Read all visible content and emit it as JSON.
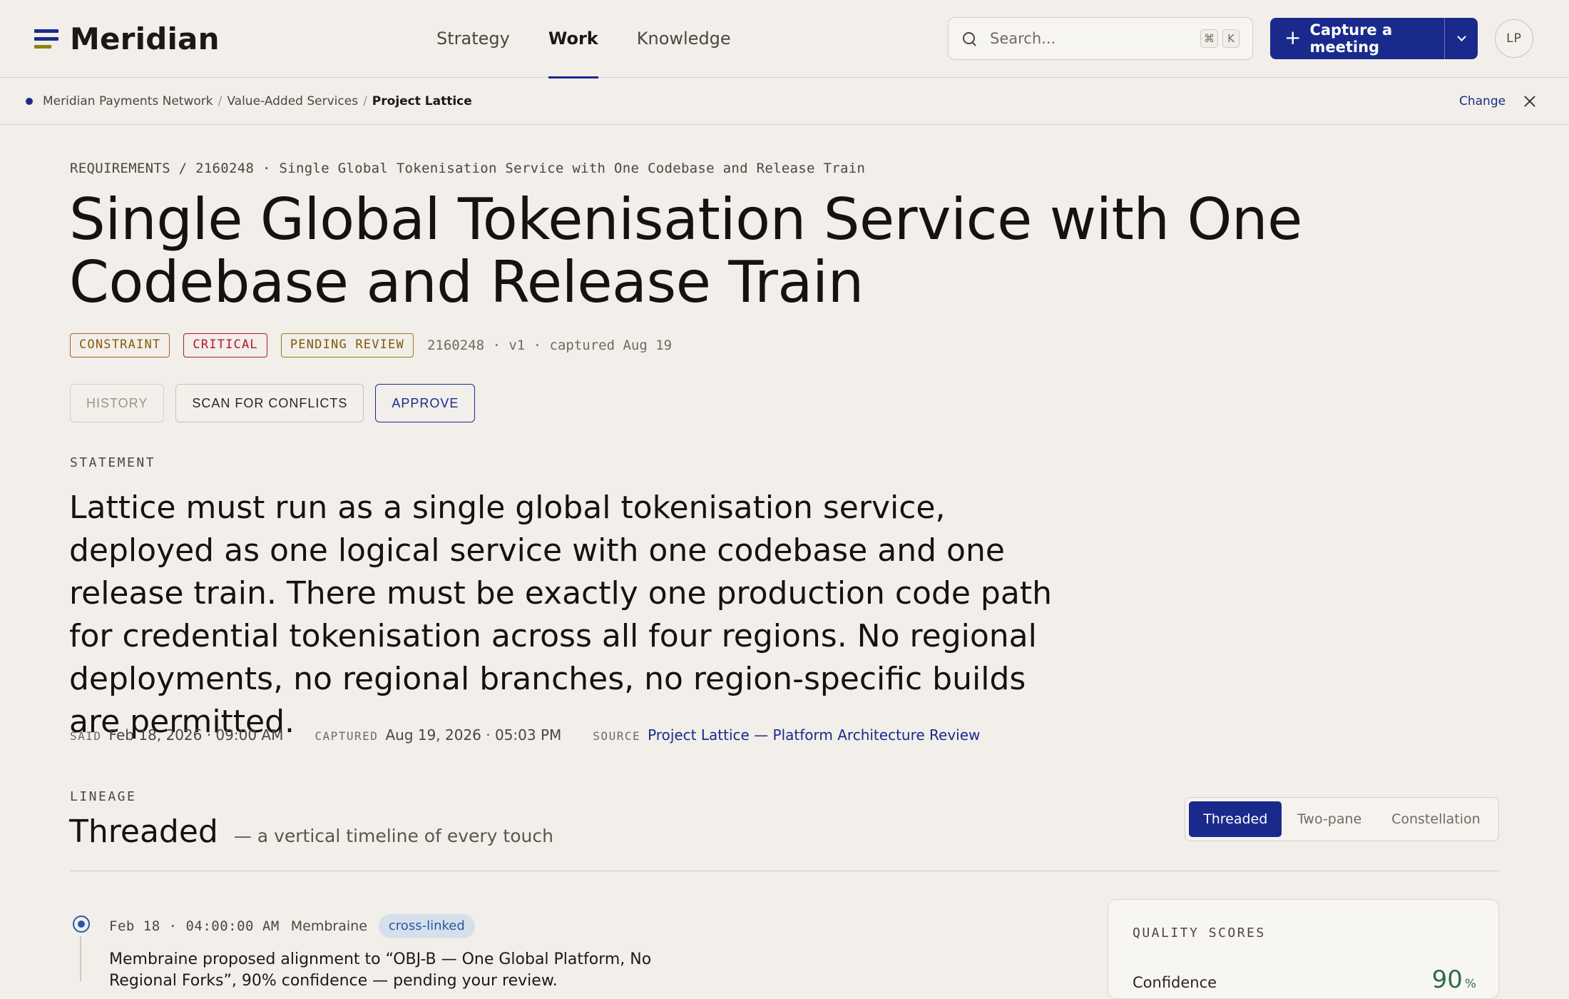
{
  "app": {
    "name": "Meridian",
    "colors": {
      "accent": "#1a2a8c",
      "brand_secondary": "#8a8416",
      "background": "#f2eee9"
    }
  },
  "nav": {
    "items": [
      {
        "label": "Strategy",
        "active": false
      },
      {
        "label": "Work",
        "active": true
      },
      {
        "label": "Knowledge",
        "active": false
      }
    ]
  },
  "search": {
    "placeholder": "Search...",
    "shortcut_mod": "⌘",
    "shortcut_key": "K"
  },
  "capture_button": {
    "label": "Capture a meeting"
  },
  "user": {
    "initials": "LP"
  },
  "breadcrumb": {
    "items": [
      "Meridian Payments Network",
      "Value-Added Services",
      "Project Lattice"
    ],
    "change_label": "Change"
  },
  "requirement": {
    "pretitle": "REQUIREMENTS / 2160248 · Single Global Tokenisation Service with One Codebase and Release Train",
    "title": "Single Global Tokenisation Service with One Codebase and Release Train",
    "badges": [
      {
        "label": "CONSTRAINT",
        "kind": "constraint"
      },
      {
        "label": "CRITICAL",
        "kind": "critical"
      },
      {
        "label": "PENDING REVIEW",
        "kind": "pending"
      }
    ],
    "meta": "2160248 · v1 · captured Aug 19",
    "actions": {
      "history": "HISTORY",
      "scan": "SCAN FOR CONFLICTS",
      "approve": "APPROVE"
    },
    "statement_label": "STATEMENT",
    "statement": "Lattice must run as a single global tokenisation service, deployed as one logical service with one codebase and one release train. There must be exactly one production code path for credential tokenisation across all four regions. No regional deployments, no regional branches, no region-specific builds are permitted.",
    "said_label": "SAID",
    "said": "Feb 18, 2026 · 09:00 AM",
    "captured_label": "CAPTURED",
    "captured": "Aug 19, 2026 · 05:03 PM",
    "source_label": "SOURCE",
    "source": "Project Lattice — Platform Architecture Review"
  },
  "lineage": {
    "label": "LINEAGE",
    "title": "Threaded",
    "subtitle": "— a vertical timeline of every touch",
    "views": [
      "Threaded",
      "Two-pane",
      "Constellation"
    ],
    "selected_view": "Threaded",
    "events": [
      {
        "date": "Feb 18 · 04:00:00 AM",
        "actor": "Membraine",
        "tag": "cross-linked",
        "text": "Membraine proposed alignment to “OBJ-B — One Global Platform, No Regional Forks”, 90% confidence — pending your review."
      }
    ]
  },
  "quality_scores": {
    "label": "QUALITY SCORES",
    "rows": [
      {
        "name": "Confidence",
        "value": "90",
        "unit": "%"
      }
    ]
  }
}
